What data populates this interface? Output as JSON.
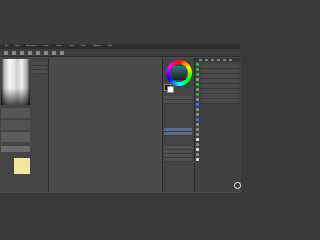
{
  "menubar": {
    "items": [
      "File",
      "Edit",
      "Animation",
      "Layer",
      "Select",
      "View",
      "Filter",
      "Window",
      "Help"
    ]
  },
  "colors": {
    "accent": "#5a6a88",
    "canvas": "#4b4b4b",
    "window": "#4a4a4a"
  },
  "icons": {
    "navigator": "navigator-icon",
    "color_wheel": "color-wheel-icon",
    "settings": "gear-icon"
  }
}
